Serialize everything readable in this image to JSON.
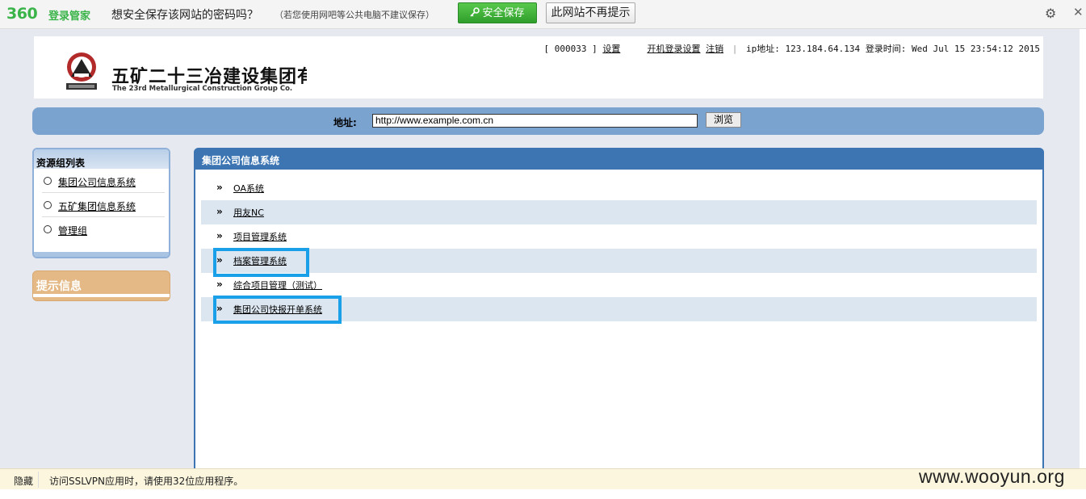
{
  "pwbar": {
    "brand": "360",
    "brand_sub": "登录管家",
    "question": "想安全保存该网站的密码吗？",
    "hint": "（若您使用网吧等公共电脑不建议保存）",
    "save_label": "安全保存",
    "never_label": "此网站不再提示",
    "settings_icon": "gear-icon",
    "close_icon": "close-icon"
  },
  "header": {
    "company_cn": "五矿二十三冶建设集团有限公司",
    "company_en": "The 23rd Metallurgical Construction Group Co.",
    "user_id": "[ 000033 ]",
    "settings_link": "设置",
    "boot_login_link": "开机登录设置",
    "logout_link": "注销",
    "ip_label": "ip地址:",
    "ip_value": "123.184.64.134",
    "login_time_label": "登录时间:",
    "login_time_value": "Wed Jul 15 23:54:12 2015"
  },
  "address": {
    "label": "地址:",
    "value": "http://www.example.com.cn",
    "browse_label": "浏览"
  },
  "sidebar": {
    "title": "资源组列表",
    "items": [
      {
        "label": "集团公司信息系统"
      },
      {
        "label": "五矿集团信息系统"
      },
      {
        "label": "管理组"
      }
    ],
    "tip_title": "提示信息"
  },
  "main": {
    "title": "集团公司信息系统",
    "arrow": "»",
    "items": [
      {
        "label": "OA系统"
      },
      {
        "label": "用友NC"
      },
      {
        "label": "项目管理系统"
      },
      {
        "label": "档案管理系统"
      },
      {
        "label": "综合项目管理（测试）"
      },
      {
        "label": "集团公司快报开单系统"
      }
    ]
  },
  "status": {
    "hide_label": "隐藏",
    "message": "访问SSLVPN应用时，请使用32位应用程序。"
  },
  "watermark": "www.wooyun.org",
  "colors": {
    "brand_green": "#3ab449",
    "accent_blue": "#3d75b3",
    "address_bar": "#7aa3d0",
    "highlight": "#1aa0e8",
    "tip_orange": "#e4b985"
  }
}
